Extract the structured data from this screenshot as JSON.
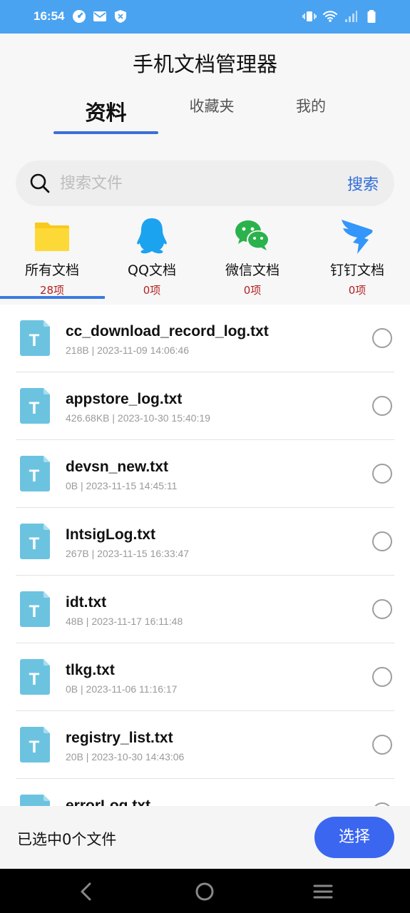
{
  "status_bar": {
    "time": "16:54",
    "left_icons": [
      "speedometer-icon",
      "mail-icon",
      "shield-icon"
    ],
    "right_icons": [
      "vibrate-icon",
      "wifi-icon",
      "signal-icon",
      "battery-icon"
    ]
  },
  "app": {
    "title": "手机文档管理器"
  },
  "tabs": [
    {
      "label": "资料",
      "active": true
    },
    {
      "label": "收藏夹",
      "active": false
    },
    {
      "label": "我的",
      "active": false
    }
  ],
  "search": {
    "placeholder": "搜索文件",
    "value": "",
    "button_label": "搜索"
  },
  "categories": [
    {
      "label": "所有文档",
      "count": "28项",
      "icon": "folder-icon",
      "active": true
    },
    {
      "label": "QQ文档",
      "count": "0项",
      "icon": "qq-icon",
      "active": false
    },
    {
      "label": "微信文档",
      "count": "0项",
      "icon": "wechat-icon",
      "active": false
    },
    {
      "label": "钉钉文档",
      "count": "0项",
      "icon": "dingtalk-icon",
      "active": false
    }
  ],
  "files": [
    {
      "name": "cc_download_record_log.txt",
      "meta": "218B | 2023-11-09 14:06:46"
    },
    {
      "name": "appstore_log.txt",
      "meta": "426.68KB | 2023-10-30 15:40:19"
    },
    {
      "name": "devsn_new.txt",
      "meta": "0B | 2023-11-15 14:45:11"
    },
    {
      "name": "IntsigLog.txt",
      "meta": "267B | 2023-11-15 16:33:47"
    },
    {
      "name": "idt.txt",
      "meta": "48B | 2023-11-17 16:11:48"
    },
    {
      "name": "tlkg.txt",
      "meta": "0B | 2023-11-06 11:16:17"
    },
    {
      "name": "registry_list.txt",
      "meta": "20B | 2023-10-30 14:43:06"
    },
    {
      "name": "errorLog.txt",
      "meta": ""
    }
  ],
  "file_icon_letter": "T",
  "bottom": {
    "selected_text": "已选中0个文件",
    "select_button": "选择"
  },
  "nav": {
    "icons": [
      "back-icon",
      "home-icon",
      "menu-icon"
    ]
  },
  "colors": {
    "status_bar": "#4aa3f0",
    "accent": "#3a66f0",
    "count": "#b22222",
    "file_icon": "#6cc3e0"
  }
}
